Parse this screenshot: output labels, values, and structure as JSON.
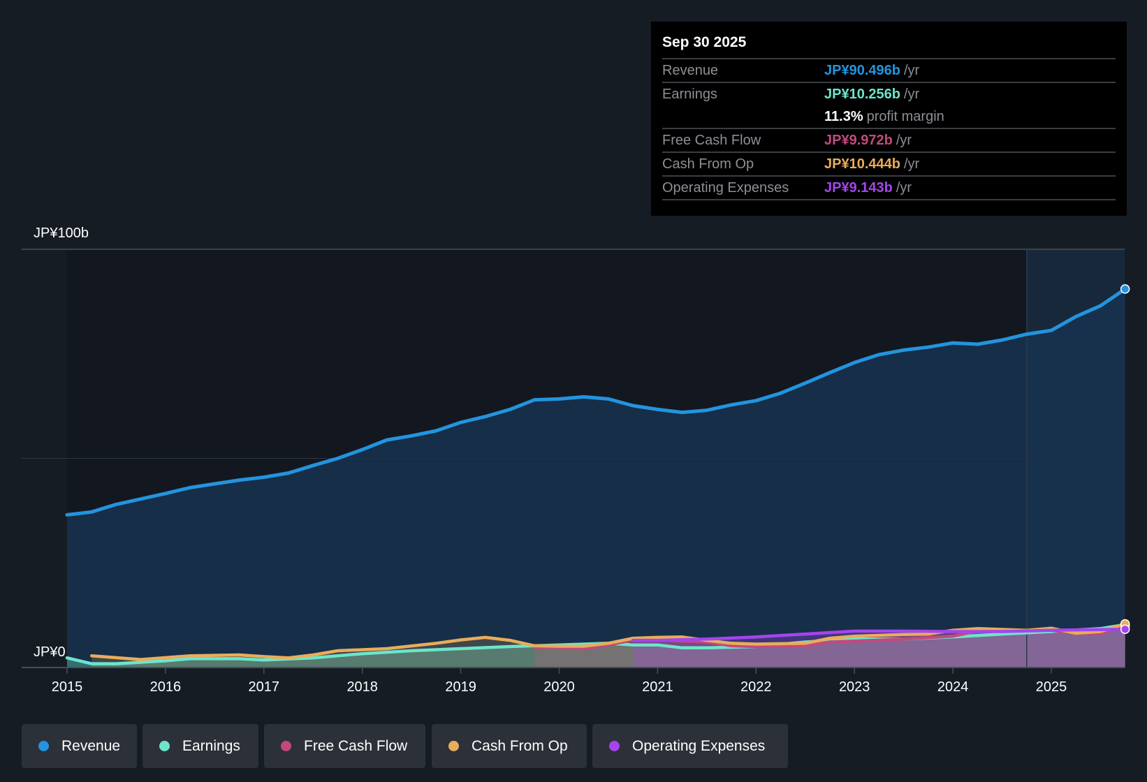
{
  "tooltip": {
    "date": "Sep 30 2025",
    "rows": [
      {
        "label": "Revenue",
        "value": "JP¥90.496b",
        "unit": "/yr",
        "color": "#2394df"
      },
      {
        "label": "Earnings",
        "value": "JP¥10.256b",
        "unit": "/yr",
        "color": "#6ce5cc"
      },
      {
        "label": "",
        "value": "11.3%",
        "unit": "profit margin",
        "color": "#ffffff"
      },
      {
        "label": "Free Cash Flow",
        "value": "JP¥9.972b",
        "unit": "/yr",
        "color": "#c2497f"
      },
      {
        "label": "Cash From Op",
        "value": "JP¥10.444b",
        "unit": "/yr",
        "color": "#e8ad5b"
      },
      {
        "label": "Operating Expenses",
        "value": "JP¥9.143b",
        "unit": "/yr",
        "color": "#a445ec"
      }
    ]
  },
  "chart_data": {
    "type": "line",
    "title": "",
    "y_axis": {
      "top_label": "JP¥100b",
      "bottom_label": "JP¥0",
      "ylim": [
        0,
        100
      ],
      "unit": "JP¥ billions"
    },
    "x_ticks": [
      "2015",
      "2016",
      "2017",
      "2018",
      "2019",
      "2020",
      "2021",
      "2022",
      "2023",
      "2024",
      "2025"
    ],
    "xlim": [
      2015,
      2025.75
    ],
    "forecast_shade_start": 2024.75,
    "legend_position": "bottom-left",
    "series": [
      {
        "name": "Revenue",
        "color": "#2394df",
        "points": [
          [
            2015,
            36.5
          ],
          [
            2015.25,
            37.2
          ],
          [
            2015.5,
            39
          ],
          [
            2016,
            41.6
          ],
          [
            2016.25,
            43
          ],
          [
            2016.75,
            44.8
          ],
          [
            2017,
            45.5
          ],
          [
            2017.25,
            46.5
          ],
          [
            2017.5,
            48.3
          ],
          [
            2017.75,
            50
          ],
          [
            2018,
            52.1
          ],
          [
            2018.25,
            54.4
          ],
          [
            2018.5,
            55.4
          ],
          [
            2018.75,
            56.6
          ],
          [
            2019,
            58.6
          ],
          [
            2019.25,
            60
          ],
          [
            2019.5,
            61.7
          ],
          [
            2019.75,
            64
          ],
          [
            2020,
            64.2
          ],
          [
            2020.25,
            64.7
          ],
          [
            2020.5,
            64.2
          ],
          [
            2020.75,
            62.6
          ],
          [
            2021,
            61.7
          ],
          [
            2021.25,
            61
          ],
          [
            2021.5,
            61.5
          ],
          [
            2021.75,
            62.8
          ],
          [
            2022,
            63.8
          ],
          [
            2022.25,
            65.6
          ],
          [
            2022.5,
            68
          ],
          [
            2022.75,
            70.5
          ],
          [
            2023,
            72.9
          ],
          [
            2023.25,
            74.8
          ],
          [
            2023.5,
            75.9
          ],
          [
            2023.75,
            76.6
          ],
          [
            2024,
            77.6
          ],
          [
            2024.25,
            77.3
          ],
          [
            2024.5,
            78.3
          ],
          [
            2024.75,
            79.7
          ],
          [
            2025,
            80.6
          ],
          [
            2025.25,
            83.9
          ],
          [
            2025.5,
            86.5
          ],
          [
            2025.75,
            90.5
          ]
        ]
      },
      {
        "name": "Earnings",
        "color": "#6ce5cc",
        "points": [
          [
            2015,
            2.3
          ],
          [
            2015.25,
            0.9
          ],
          [
            2015.5,
            0.9
          ],
          [
            2016,
            1.6
          ],
          [
            2016.25,
            2.1
          ],
          [
            2016.75,
            2.1
          ],
          [
            2017,
            1.8
          ],
          [
            2017.5,
            2.3
          ],
          [
            2018,
            3.3
          ],
          [
            2018.5,
            4
          ],
          [
            2019,
            4.5
          ],
          [
            2019.5,
            5
          ],
          [
            2020,
            5.4
          ],
          [
            2020.5,
            5.8
          ],
          [
            2020.75,
            5.4
          ],
          [
            2021,
            5.4
          ],
          [
            2021.25,
            4.7
          ],
          [
            2021.5,
            4.7
          ],
          [
            2022,
            5
          ],
          [
            2022.5,
            6.1
          ],
          [
            2023,
            6.8
          ],
          [
            2023.5,
            6.8
          ],
          [
            2024,
            7.3
          ],
          [
            2024.5,
            8
          ],
          [
            2025,
            8.6
          ],
          [
            2025.5,
            9.3
          ],
          [
            2025.75,
            10.256
          ]
        ]
      },
      {
        "name": "Free Cash Flow",
        "color": "#c2497f",
        "points": [
          [
            2019.75,
            4.9
          ],
          [
            2020,
            4.7
          ],
          [
            2020.25,
            4.5
          ],
          [
            2020.5,
            5.4
          ],
          [
            2020.75,
            6.6
          ],
          [
            2021,
            6.6
          ],
          [
            2021.5,
            6.1
          ],
          [
            2021.75,
            5.2
          ],
          [
            2022,
            5
          ],
          [
            2022.5,
            5.2
          ],
          [
            2022.75,
            6.1
          ],
          [
            2023,
            6.3
          ],
          [
            2023.5,
            6.8
          ],
          [
            2024,
            7.5
          ],
          [
            2024.25,
            8.7
          ],
          [
            2024.75,
            8.9
          ],
          [
            2025,
            8.9
          ],
          [
            2025.25,
            8.2
          ],
          [
            2025.5,
            8.2
          ],
          [
            2025.75,
            9.972
          ]
        ]
      },
      {
        "name": "Cash From Op",
        "color": "#e8ad5b",
        "points": [
          [
            2015.25,
            2.8
          ],
          [
            2015.75,
            1.9
          ],
          [
            2016.25,
            2.8
          ],
          [
            2016.75,
            3
          ],
          [
            2017,
            2.6
          ],
          [
            2017.25,
            2.3
          ],
          [
            2017.5,
            3
          ],
          [
            2017.75,
            4
          ],
          [
            2018.25,
            4.5
          ],
          [
            2018.75,
            5.8
          ],
          [
            2019,
            6.6
          ],
          [
            2019.25,
            7.2
          ],
          [
            2019.5,
            6.5
          ],
          [
            2019.75,
            5.2
          ],
          [
            2020,
            5.1
          ],
          [
            2020.25,
            5.1
          ],
          [
            2020.5,
            5.8
          ],
          [
            2020.75,
            7
          ],
          [
            2021,
            7.2
          ],
          [
            2021.25,
            7.3
          ],
          [
            2021.5,
            6.5
          ],
          [
            2021.75,
            5.8
          ],
          [
            2022,
            5.6
          ],
          [
            2022.5,
            5.8
          ],
          [
            2022.75,
            7
          ],
          [
            2023,
            7.5
          ],
          [
            2023.5,
            7.9
          ],
          [
            2023.75,
            8
          ],
          [
            2024,
            8.9
          ],
          [
            2024.25,
            9.3
          ],
          [
            2024.75,
            8.9
          ],
          [
            2025,
            9.4
          ],
          [
            2025.25,
            8.2
          ],
          [
            2025.5,
            8.6
          ],
          [
            2025.75,
            10.444
          ]
        ]
      },
      {
        "name": "Operating Expenses",
        "color": "#a445ec",
        "points": [
          [
            2020.75,
            6.5
          ],
          [
            2021,
            6.5
          ],
          [
            2021.5,
            6.8
          ],
          [
            2022,
            7.3
          ],
          [
            2022.5,
            8
          ],
          [
            2023,
            8.7
          ],
          [
            2023.5,
            8.7
          ],
          [
            2024,
            8.6
          ],
          [
            2024.5,
            8.6
          ],
          [
            2025,
            8.9
          ],
          [
            2025.75,
            9.143
          ]
        ]
      }
    ]
  },
  "legend": [
    {
      "label": "Revenue",
      "color": "#2394df"
    },
    {
      "label": "Earnings",
      "color": "#6ce5cc"
    },
    {
      "label": "Free Cash Flow",
      "color": "#c2497f"
    },
    {
      "label": "Cash From Op",
      "color": "#e8ad5b"
    },
    {
      "label": "Operating Expenses",
      "color": "#a445ec"
    }
  ]
}
